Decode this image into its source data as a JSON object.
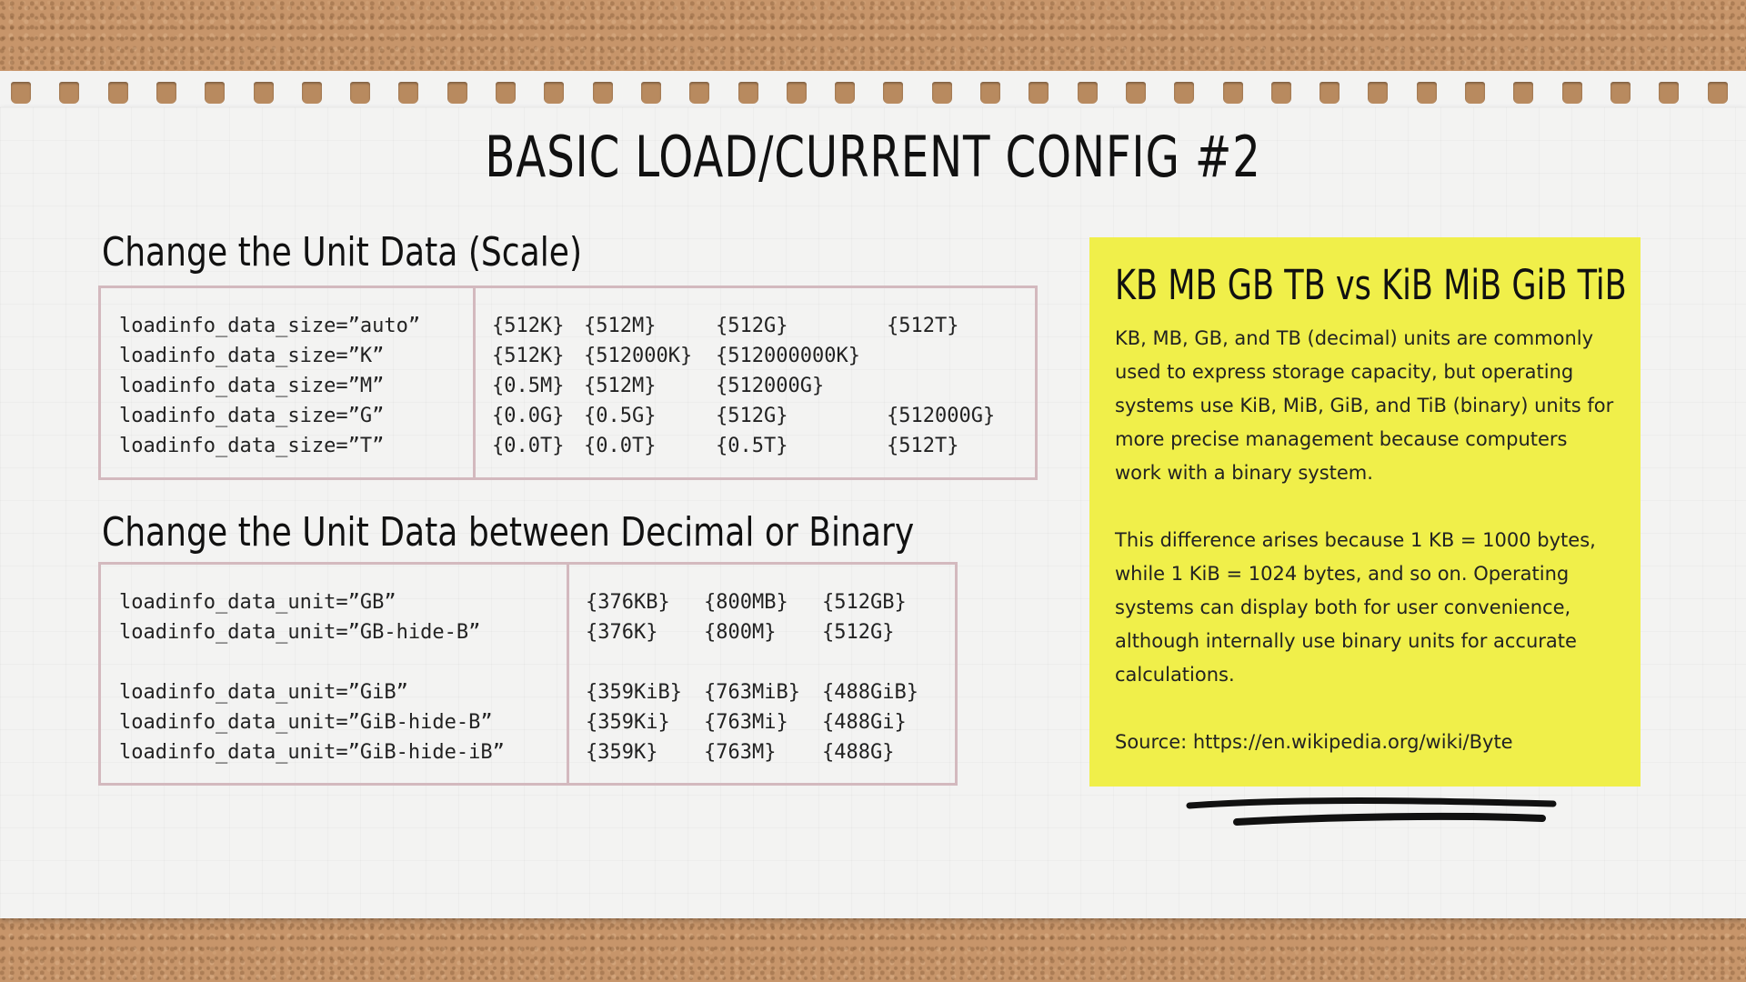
{
  "title": "BASIC LOAD/CURRENT CONFIG #2",
  "scale_section": {
    "heading": "Change the Unit Data (Scale)",
    "rows": [
      {
        "config": "loadinfo_data_size=”auto”",
        "values": [
          "{512K}",
          "{512M}",
          "{512G}",
          "{512T}"
        ]
      },
      {
        "config": "loadinfo_data_size=”K”",
        "values": [
          "{512K}",
          "{512000K}",
          "{512000000K}",
          ""
        ]
      },
      {
        "config": "loadinfo_data_size=”M”",
        "values": [
          "{0.5M}",
          "{512M}",
          "{512000G}",
          ""
        ]
      },
      {
        "config": "loadinfo_data_size=”G”",
        "values": [
          "{0.0G}",
          "{0.5G}",
          "{512G}",
          "{512000G}"
        ]
      },
      {
        "config": "loadinfo_data_size=”T”",
        "values": [
          "{0.0T}",
          "{0.0T}",
          "{0.5T}",
          "{512T}"
        ]
      }
    ]
  },
  "unit_section": {
    "heading": "Change the Unit Data between Decimal or Binary",
    "rows": [
      {
        "config": "loadinfo_data_unit=”GB”",
        "values": [
          "{376KB}",
          "{800MB}",
          "{512GB}"
        ]
      },
      {
        "config": "loadinfo_data_unit=”GB-hide-B”",
        "values": [
          "{376K}",
          "{800M}",
          "{512G}"
        ]
      },
      {
        "config": "",
        "values": [
          "",
          "",
          ""
        ]
      },
      {
        "config": "loadinfo_data_unit=”GiB”",
        "values": [
          "{359KiB}",
          "{763MiB}",
          "{488GiB}"
        ]
      },
      {
        "config": "loadinfo_data_unit=”GiB-hide-B”",
        "values": [
          "{359Ki}",
          "{763Mi}",
          "{488Gi}"
        ]
      },
      {
        "config": "loadinfo_data_unit=”GiB-hide-iB”",
        "values": [
          "{359K}",
          "{763M}",
          "{488G}"
        ]
      }
    ]
  },
  "note": {
    "title": "KB MB GB TB  vs  KiB MiB GiB TiB",
    "paragraph1": "KB, MB, GB, and TB (decimal) units are commonly used to express storage capacity, but operating systems use KiB, MiB, GiB, and TiB (binary) units for more precise management because computers work with a binary system.",
    "paragraph2": "This difference arises because 1 KB = 1000 bytes, while 1 KiB = 1024 bytes, and so on. Operating systems can display both for user convenience, although internally use binary units for accurate calculations.",
    "source": "Source:  https://en.wikipedia.org/wiki/Byte",
    "background": "#f0ef4a"
  }
}
